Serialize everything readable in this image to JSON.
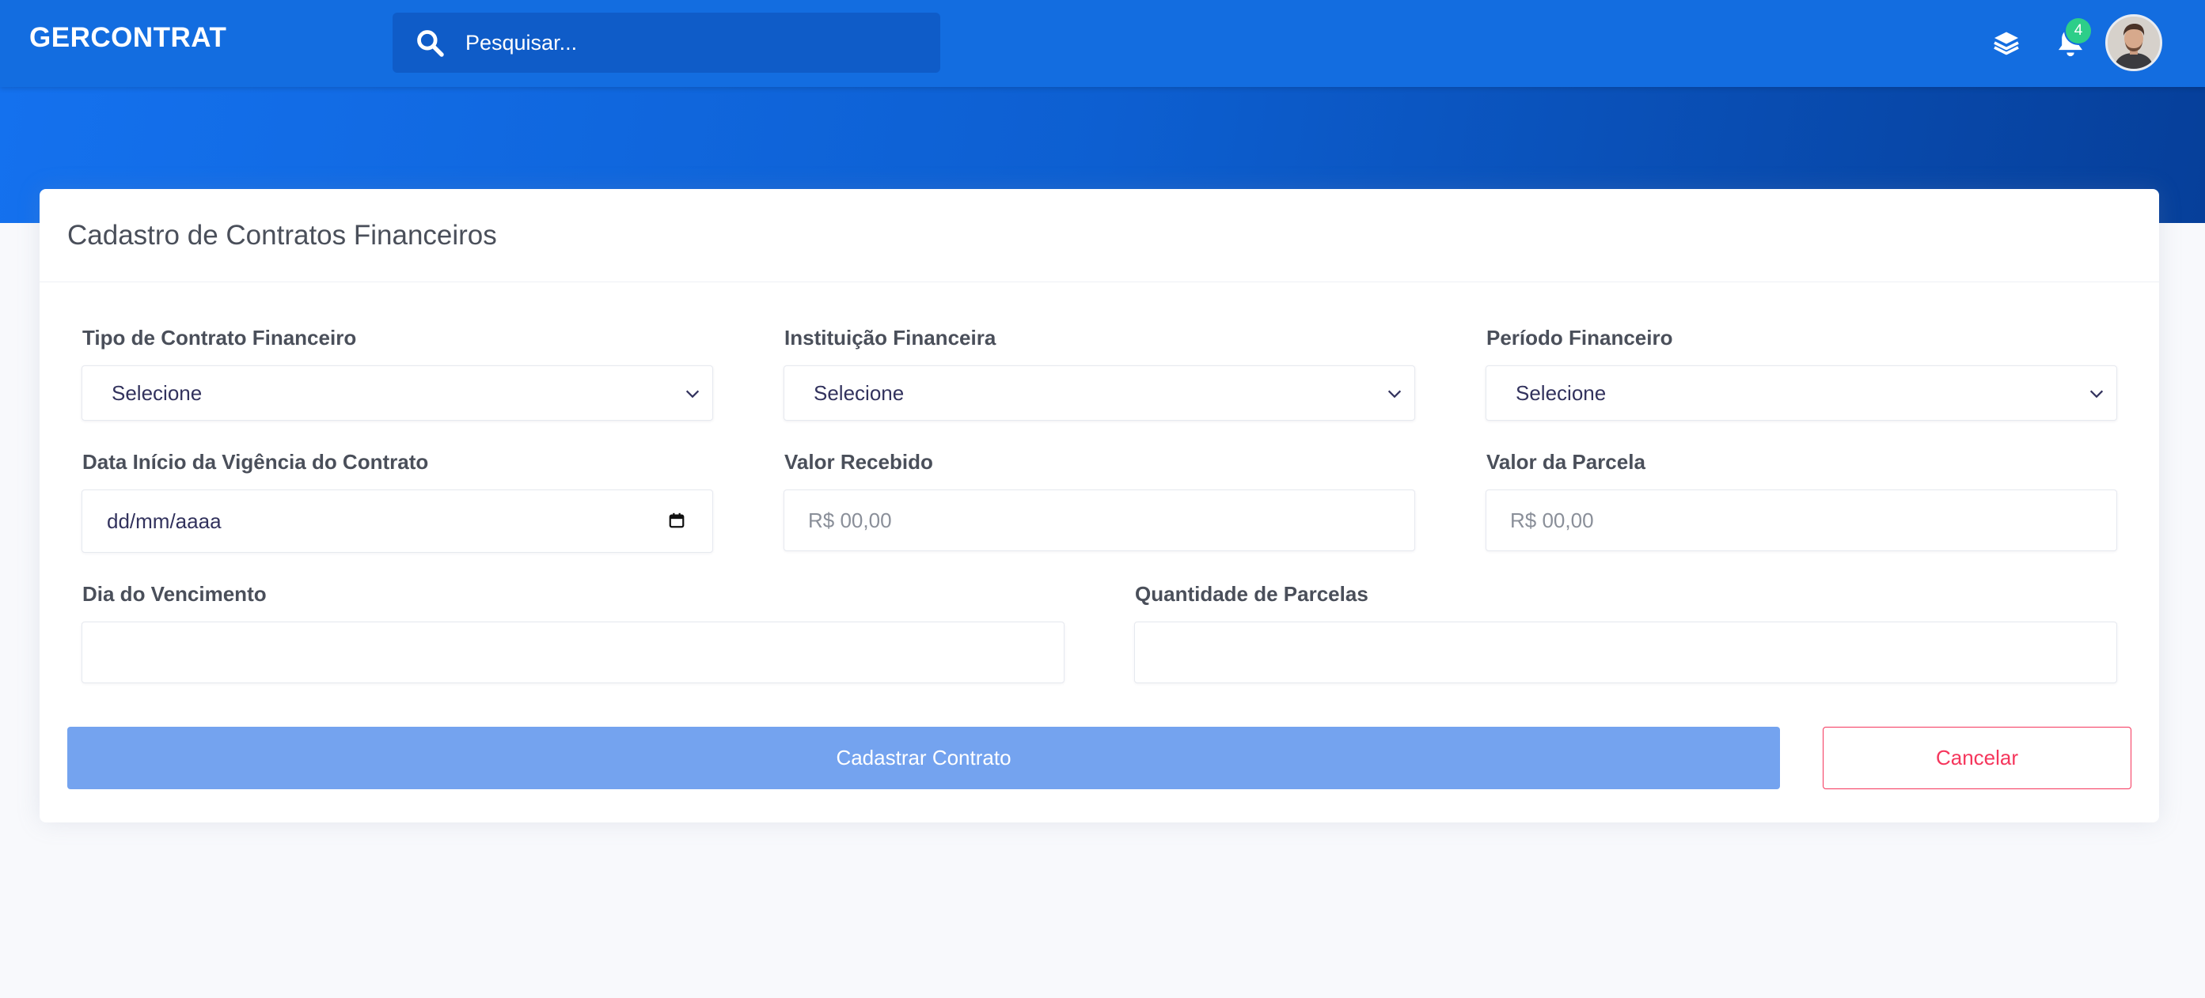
{
  "header": {
    "brand": "GERCONTRAT",
    "search_placeholder": "Pesquisar...",
    "notification_count": "4",
    "icons": [
      "search-icon",
      "layers-icon",
      "bell-icon",
      "user-avatar"
    ]
  },
  "form": {
    "title": "Cadastro de Contratos Financeiros",
    "tipo_contrato": {
      "label": "Tipo de Contrato Financeiro",
      "value": "Selecione"
    },
    "instituicao": {
      "label": "Instituição Financeira",
      "value": "Selecione"
    },
    "periodo": {
      "label": "Período Financeiro",
      "value": "Selecione"
    },
    "data_inicio": {
      "label": "Data Início da Vigência do Contrato",
      "value": "dd/mm/aaaa"
    },
    "valor_recebido": {
      "label": "Valor Recebido",
      "placeholder": "R$ 00,00"
    },
    "valor_parcela": {
      "label": "Valor da Parcela",
      "placeholder": "R$ 00,00"
    },
    "dia_vencimento": {
      "label": "Dia do Vencimento",
      "value": ""
    },
    "qtd_parcelas": {
      "label": "Quantidade de Parcelas",
      "value": ""
    },
    "submit_label": "Cadastrar Contrato",
    "cancel_label": "Cancelar"
  },
  "colors": {
    "navbar": "#136de0",
    "primary_button": "#74a3ef",
    "danger": "#f5365c",
    "badge": "#2dce89"
  }
}
